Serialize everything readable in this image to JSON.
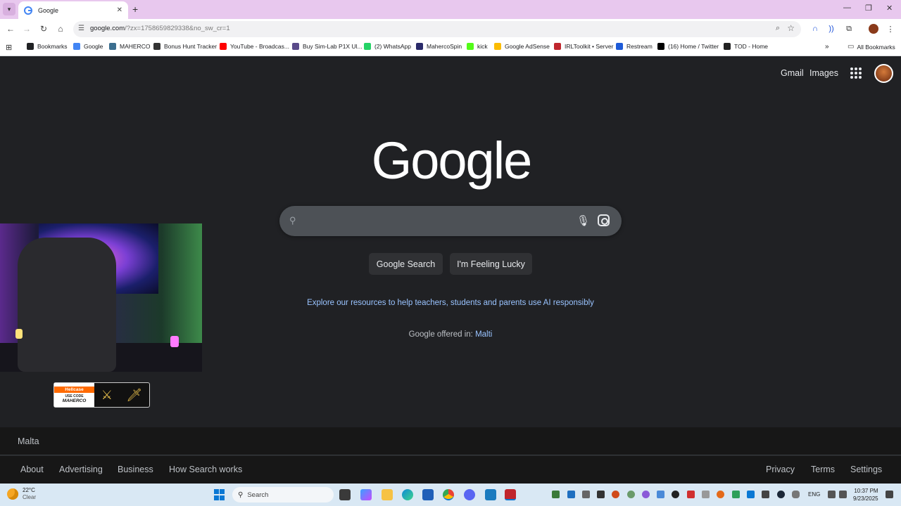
{
  "browser": {
    "tab": {
      "title": "Google",
      "close": "✕"
    },
    "new_tab": "+",
    "window_controls": {
      "minimize": "—",
      "restore": "❐",
      "close": "✕"
    },
    "url_host": "google.com",
    "url_rest": "/?zx=1758659829338&no_sw_cr=1",
    "bookmarks": [
      {
        "label": "Bookmarks",
        "icon": "star-icon",
        "color": "#202124"
      },
      {
        "label": "Google",
        "icon": "google-icon",
        "color": "#4285f4"
      },
      {
        "label": "MAHERCO",
        "icon": "maherco-icon",
        "color": "#3b6e8f"
      },
      {
        "label": "Bonus Hunt Tracker",
        "icon": "tracker-icon",
        "color": "#333333"
      },
      {
        "label": "YouTube - Broadcas...",
        "icon": "youtube-icon",
        "color": "#ff0000"
      },
      {
        "label": "Buy Sim-Lab P1X Ul...",
        "icon": "simlab-icon",
        "color": "#5a4b8a"
      },
      {
        "label": "(2) WhatsApp",
        "icon": "whatsapp-icon",
        "color": "#25d366"
      },
      {
        "label": "MahercoSpin",
        "icon": "spin-icon",
        "color": "#2a2a6a"
      },
      {
        "label": "kick",
        "icon": "kick-icon",
        "color": "#53fc18"
      },
      {
        "label": "Google AdSense",
        "icon": "adsense-icon",
        "color": "#fbbc04"
      },
      {
        "label": "IRLToolkit • Server",
        "icon": "irltoolkit-icon",
        "color": "#c0262d"
      },
      {
        "label": "Restream",
        "icon": "restream-icon",
        "color": "#1e5bd8"
      },
      {
        "label": "(16) Home / Twitter",
        "icon": "x-twitter-icon",
        "color": "#000000"
      },
      {
        "label": "TOD - Home",
        "icon": "tod-icon",
        "color": "#222222"
      }
    ],
    "more_bookmarks": "»",
    "all_bookmarks": "All Bookmarks"
  },
  "google": {
    "gmail": "Gmail",
    "images": "Images",
    "logo": "Google",
    "search_button": "Google Search",
    "lucky_button": "I'm Feeling Lucky",
    "explore": "Explore our resources to help teachers, students and parents use AI responsibly",
    "offered_prefix": "Google offered in: ",
    "offered_lang": "Malti",
    "country": "Malta",
    "footer_left": [
      "About",
      "Advertising",
      "Business",
      "How Search works"
    ],
    "footer_right": [
      "Privacy",
      "Terms",
      "Settings"
    ]
  },
  "overlay": {
    "badge_brand": "Hellcase",
    "badge_use": "USE CODE",
    "badge_code": "MAHERCO"
  },
  "taskbar": {
    "temp": "22°C",
    "weather": "Clear",
    "search_placeholder": "Search",
    "lang": "ENG",
    "time": "10:37 PM",
    "date": "9/23/2025"
  }
}
